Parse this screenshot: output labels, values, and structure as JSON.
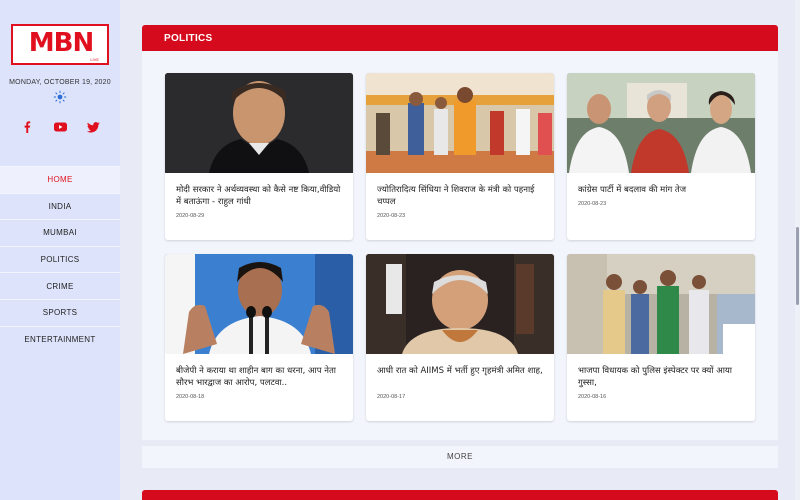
{
  "brand": {
    "logo_text": "MBN",
    "logo_sub": "LIVE"
  },
  "date": "MONDAY, OCTOBER 19, 2020",
  "icons": {
    "weather": "sun-icon",
    "social": [
      "facebook-icon",
      "youtube-icon",
      "twitter-icon"
    ]
  },
  "nav": [
    {
      "label": "HOME",
      "active": true
    },
    {
      "label": "INDIA"
    },
    {
      "label": "MUMBAI"
    },
    {
      "label": "POLITICS"
    },
    {
      "label": "CRIME"
    },
    {
      "label": "SPORTS"
    },
    {
      "label": "ENTERTAINMENT"
    }
  ],
  "section": {
    "title": "POLITICS"
  },
  "cards": [
    {
      "title": "मोदी सरकार ने अर्थव्यवस्था को कैसे नष्ट किया,वीडियो में बताऊंगा - राहुल गांधी",
      "date": "2020-08-29"
    },
    {
      "title": "ज्योतिरादित्य सिंधिया ने शिवराज के मंत्री को पहनाई चप्पल",
      "date": "2020-08-23"
    },
    {
      "title": "कांग्रेस पार्टी में बदलाव की मांग तेज",
      "date": "2020-08-23"
    },
    {
      "title": "बीजेपी ने कराया था शाहीन बाग का धरना, आप नेता सौरभ भारद्वाज का आरोप, पलटवा..",
      "date": "2020-08-18"
    },
    {
      "title": "आधी रात को AIIMS में भर्ती हुए गृहमंत्री अमित शाह,",
      "date": "2020-08-17"
    },
    {
      "title": "भाजपा विधायक को पुलिस इंस्पेक्टर पर क्यों आया गुस्सा,",
      "date": "2020-08-16"
    }
  ],
  "more_label": "MORE",
  "colors": {
    "accent": "#d50a1c",
    "sidebar": "#dde3fa",
    "page": "#e8eaf6"
  }
}
